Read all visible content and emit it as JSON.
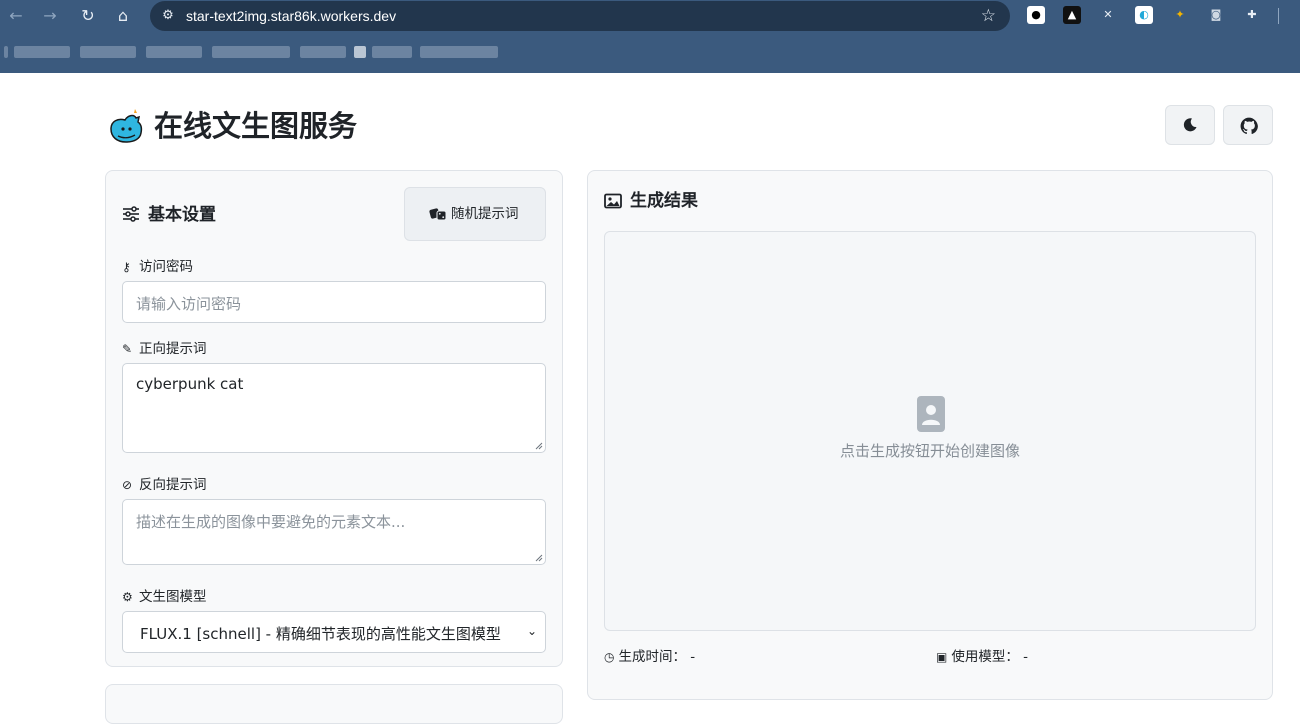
{
  "browser": {
    "url": "star-text2img.star86k.workers.dev",
    "nav": {
      "back": "←",
      "forward": "→",
      "reload": "↻",
      "home": "⌂"
    }
  },
  "header": {
    "title": "在线文生图服务",
    "theme_icon": "moon-icon",
    "github_icon": "github-icon"
  },
  "settings": {
    "title": "基本设置",
    "random_button": "随机提示词",
    "password": {
      "label": "访问密码",
      "placeholder": "请输入访问密码",
      "value": ""
    },
    "prompt": {
      "label": "正向提示词",
      "value": "cyberpunk cat"
    },
    "negative": {
      "label": "反向提示词",
      "placeholder": "描述在生成的图像中要避免的元素文本..."
    },
    "model": {
      "label": "文生图模型",
      "selected": "FLUX.1 [schnell] - 精确细节表现的高性能文生图模型"
    }
  },
  "result": {
    "title": "生成结果",
    "placeholder": "点击生成按钮开始创建图像",
    "time_label": "生成时间：",
    "time_value": "-",
    "model_label": "使用模型：",
    "model_value": "-"
  },
  "colors": {
    "chrome": "#3b5a7e",
    "omnibox": "#22364d",
    "card_bg": "#f8f9fa",
    "logo": "#2fb6e0"
  }
}
